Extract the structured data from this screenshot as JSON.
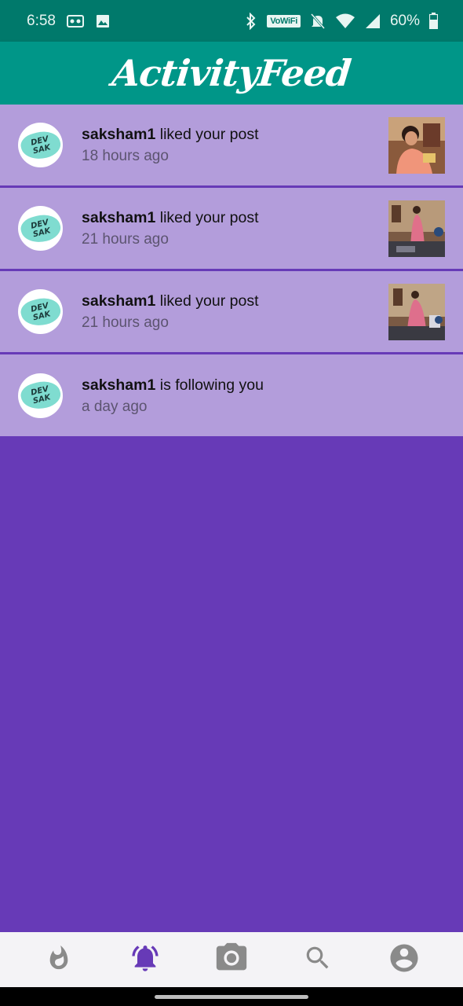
{
  "status_bar": {
    "time": "6:58",
    "volte_label": "VoWiFi",
    "battery": "60%"
  },
  "app_bar": {
    "title": "ActivityFeed"
  },
  "avatar_text": {
    "line1": "DEV",
    "line2": "SAK"
  },
  "feed": [
    {
      "username": "saksham1",
      "action": "liked your post",
      "time": "18 hours ago",
      "has_thumb": true
    },
    {
      "username": "saksham1",
      "action": "liked your post",
      "time": "21 hours ago",
      "has_thumb": true
    },
    {
      "username": "saksham1",
      "action": "liked your post",
      "time": "21 hours ago",
      "has_thumb": true
    },
    {
      "username": "saksham1",
      "action": "is following you",
      "time": "a day ago",
      "has_thumb": false
    }
  ],
  "bottom_nav": [
    {
      "icon": "whatshot-icon",
      "active": false
    },
    {
      "icon": "notifications-active-icon",
      "active": true
    },
    {
      "icon": "photo-camera-icon",
      "active": false
    },
    {
      "icon": "search-icon",
      "active": false
    },
    {
      "icon": "account-circle-icon",
      "active": false
    }
  ],
  "colors": {
    "status_bar": "#00796b",
    "app_bar": "#009688",
    "feed_item": "#b39ddb",
    "background": "#673ab7",
    "nav_active": "#673ab7",
    "nav_inactive": "#8a8a8a"
  }
}
